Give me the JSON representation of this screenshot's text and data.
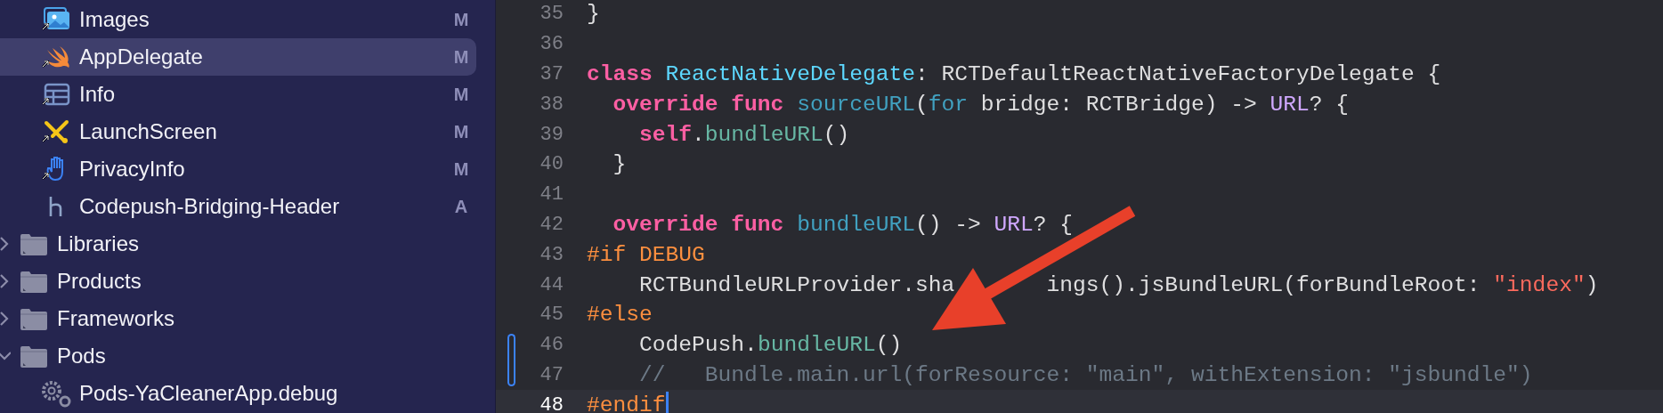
{
  "navigator": {
    "items": [
      {
        "label": "Images",
        "kind": "assets",
        "badge": "M",
        "selected": false
      },
      {
        "label": "AppDelegate",
        "kind": "swift",
        "badge": "M",
        "selected": true
      },
      {
        "label": "Info",
        "kind": "plist",
        "badge": "M",
        "selected": false
      },
      {
        "label": "LaunchScreen",
        "kind": "storyboard",
        "badge": "M",
        "selected": false
      },
      {
        "label": "PrivacyInfo",
        "kind": "privacy",
        "badge": "M",
        "selected": false
      },
      {
        "label": "Codepush-Bridging-Header",
        "kind": "header",
        "badge": "A",
        "selected": false
      },
      {
        "label": "Libraries",
        "kind": "folder",
        "expanded": false,
        "selected": false
      },
      {
        "label": "Products",
        "kind": "folder",
        "expanded": false,
        "selected": false
      },
      {
        "label": "Frameworks",
        "kind": "folder",
        "expanded": false,
        "selected": false
      },
      {
        "label": "Pods",
        "kind": "folder",
        "expanded": true,
        "selected": false
      },
      {
        "label": "Pods-YaCleanerApp.debug",
        "kind": "config",
        "selected": false
      }
    ]
  },
  "editor": {
    "lines": [
      {
        "number": "35",
        "changed": false,
        "current": false,
        "tokens": [
          {
            "text": "}",
            "kind": "plain"
          }
        ]
      },
      {
        "number": "36",
        "changed": false,
        "current": false
      },
      {
        "number": "37",
        "changed": false,
        "current": false,
        "tokens": [
          {
            "text": "class ",
            "kind": "keyword"
          },
          {
            "text": "ReactNativeDelegate",
            "kind": "typedecl"
          },
          {
            "text": ": RCTDefaultReactNativeFactoryDelegate {",
            "kind": "plain"
          }
        ]
      },
      {
        "number": "38",
        "changed": false,
        "current": false,
        "tokens": [
          {
            "text": "  override func ",
            "kind": "keyword"
          },
          {
            "text": "sourceURL",
            "kind": "decl"
          },
          {
            "text": "(",
            "kind": "plain"
          },
          {
            "text": "for",
            "kind": "decl"
          },
          {
            "text": " bridge: RCTBridge) -> ",
            "kind": "plain"
          },
          {
            "text": "URL",
            "kind": "type"
          },
          {
            "text": "? {",
            "kind": "plain"
          }
        ]
      },
      {
        "number": "39",
        "changed": false,
        "current": false,
        "tokens": [
          {
            "text": "    self",
            "kind": "keyword"
          },
          {
            "text": ".",
            "kind": "plain"
          },
          {
            "text": "bundleURL",
            "kind": "call"
          },
          {
            "text": "()",
            "kind": "plain"
          }
        ]
      },
      {
        "number": "40",
        "changed": false,
        "current": false,
        "tokens": [
          {
            "text": "  }",
            "kind": "plain"
          }
        ]
      },
      {
        "number": "41",
        "changed": false,
        "current": false
      },
      {
        "number": "42",
        "changed": false,
        "current": false,
        "tokens": [
          {
            "text": "  override func ",
            "kind": "keyword"
          },
          {
            "text": "bundleURL",
            "kind": "decl"
          },
          {
            "text": "() -> ",
            "kind": "plain"
          },
          {
            "text": "URL",
            "kind": "type"
          },
          {
            "text": "? {",
            "kind": "plain"
          }
        ]
      },
      {
        "number": "43",
        "changed": false,
        "current": false,
        "tokens": [
          {
            "text": "#if DEBUG",
            "kind": "preproc"
          }
        ]
      },
      {
        "number": "44",
        "changed": false,
        "current": false,
        "tokens": [
          {
            "text": "    RCTBundleURLProvider.sha",
            "kind": "plain"
          },
          {
            "kind": "covered"
          },
          {
            "text": "ings().jsBundleURL(forBundleRoot: ",
            "kind": "plain"
          },
          {
            "text": "\"index\"",
            "kind": "string"
          },
          {
            "text": ")",
            "kind": "plain"
          }
        ]
      },
      {
        "number": "45",
        "changed": false,
        "current": false,
        "tokens": [
          {
            "text": "#else",
            "kind": "preproc"
          }
        ]
      },
      {
        "number": "46",
        "changed": true,
        "current": false,
        "tokens": [
          {
            "text": "    CodePush.",
            "kind": "plain"
          },
          {
            "text": "bundleURL",
            "kind": "call"
          },
          {
            "text": "()",
            "kind": "plain"
          }
        ]
      },
      {
        "number": "47",
        "changed": true,
        "current": false,
        "tokens": [
          {
            "text": "    //   Bundle.main.url(forResource: \"main\", withExtension: \"jsbundle\")",
            "kind": "comment"
          }
        ]
      },
      {
        "number": "48",
        "changed": false,
        "current": true,
        "tokens": [
          {
            "text": "#endif",
            "kind": "preproc"
          }
        ]
      }
    ]
  }
}
